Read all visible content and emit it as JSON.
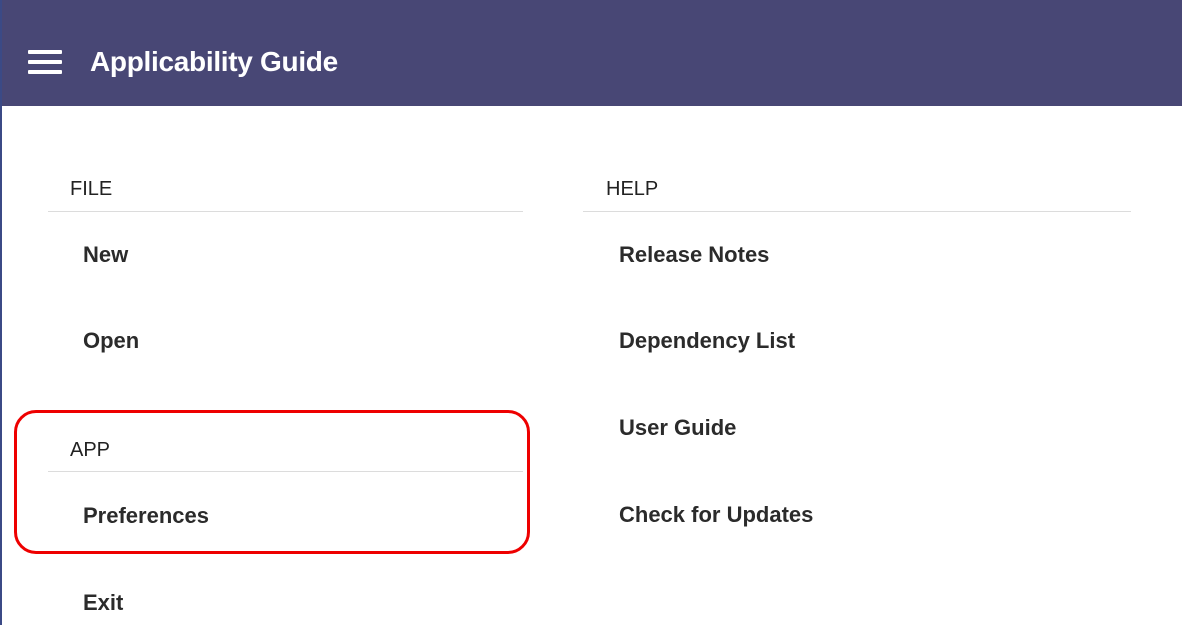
{
  "header": {
    "title": "Applicability Guide",
    "menu_icon": "hamburger-menu-icon",
    "background_color": "#484775"
  },
  "file_section": {
    "label": "FILE",
    "items": [
      "New",
      "Open"
    ]
  },
  "app_section": {
    "label": "APP",
    "items": [
      "Preferences"
    ]
  },
  "exit": {
    "label": "Exit"
  },
  "help_section": {
    "label": "HELP",
    "items": [
      "Release Notes",
      "Dependency List",
      "User Guide",
      "Check for Updates"
    ]
  },
  "highlight": {
    "color": "#ee0000"
  }
}
